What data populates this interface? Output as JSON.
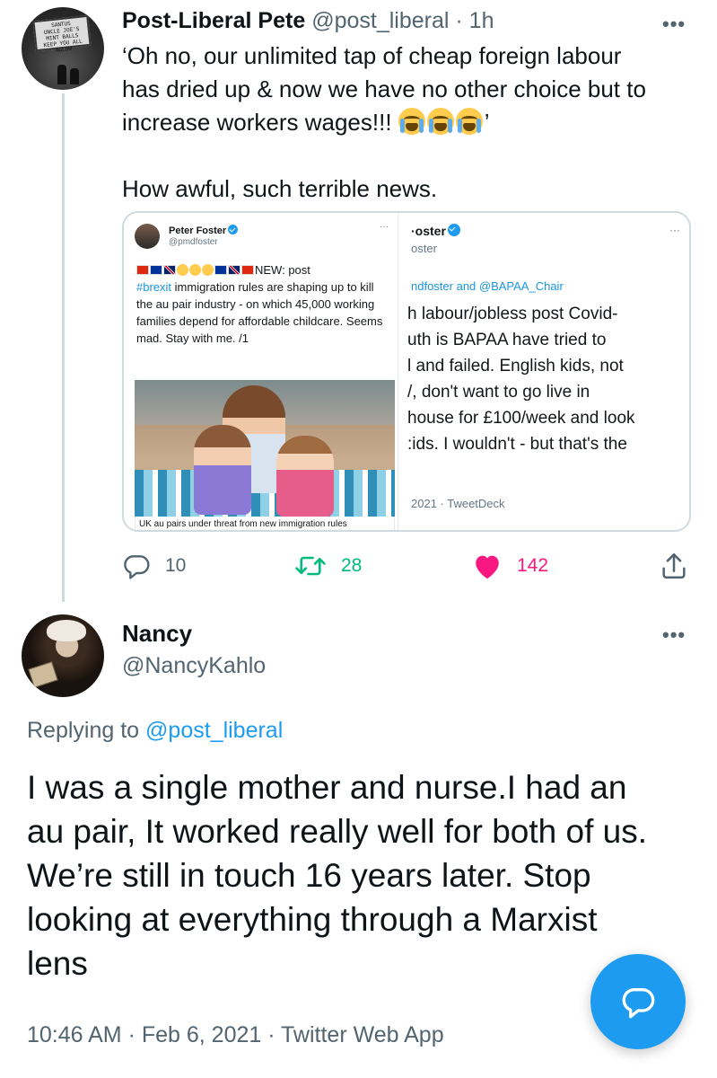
{
  "tweet1": {
    "author_name": "Post-Liberal Pete",
    "author_handle": "@post_liberal",
    "separator": "·",
    "time": "1h",
    "more_label": "•••",
    "avatar_sign": [
      "SANTUS",
      "UNCLE JOE'S",
      "MINT BALLS",
      "KEEP YOU ALL AGLOW"
    ],
    "text_lines": [
      "‘Oh no, our unlimited tap of cheap foreign labour",
      "has dried up & now we have no other choice but to",
      "increase workers wages!!!"
    ],
    "text_after_emoji": "’",
    "emoji_name": "loudly-crying-face",
    "emoji_count": 3,
    "text_second_paragraph": "How awful, such terrible news.",
    "media": {
      "left": {
        "name": "Peter Foster",
        "handle": "@pmdfoster",
        "more": "···",
        "text_lead": "NEW: post",
        "hashtag": "#brexit",
        "text_rest": " immigration rules are shaping up to kill the au pair industry - on which 45,000 working families depend for affordable childcare. Seems mad. Stay with me. /1",
        "caption": "UK au pairs under threat from new immigration rules"
      },
      "right": {
        "name": "·oster",
        "handle": "oster",
        "more": "···",
        "replying": "ndfoster and @BAPAA_Chair",
        "lines": [
          "h labour/jobless post Covid-",
          "uth is BAPAA have tried to",
          "l and failed. English kids, not",
          "/, don't want to go live in",
          " house for £100/week and look",
          ":ids. I wouldn't - but that's the"
        ],
        "meta": "2021 · TweetDeck"
      }
    },
    "actions": {
      "reply_count": "10",
      "retweet_count": "28",
      "like_count": "142",
      "liked": true
    }
  },
  "tweet2": {
    "author_name": "Nancy",
    "author_handle": "@NancyKahlo",
    "more_label": "•••",
    "replying_prefix": "Replying to ",
    "replying_to": "@post_liberal",
    "text_lines": [
      "I was a single mother and nurse.I had an",
      "au pair,  It worked really well for both of us.",
      "We’re still in touch 16 years later. Stop",
      "looking at everything through a Marxist",
      "lens"
    ],
    "timestamp": "10:46 AM · Feb 6, 2021 · Twitter Web App"
  },
  "colors": {
    "accent": "#1d9bf0",
    "like": "#f91880",
    "retweet": "#00ba7c",
    "secondary_text": "#536471"
  }
}
